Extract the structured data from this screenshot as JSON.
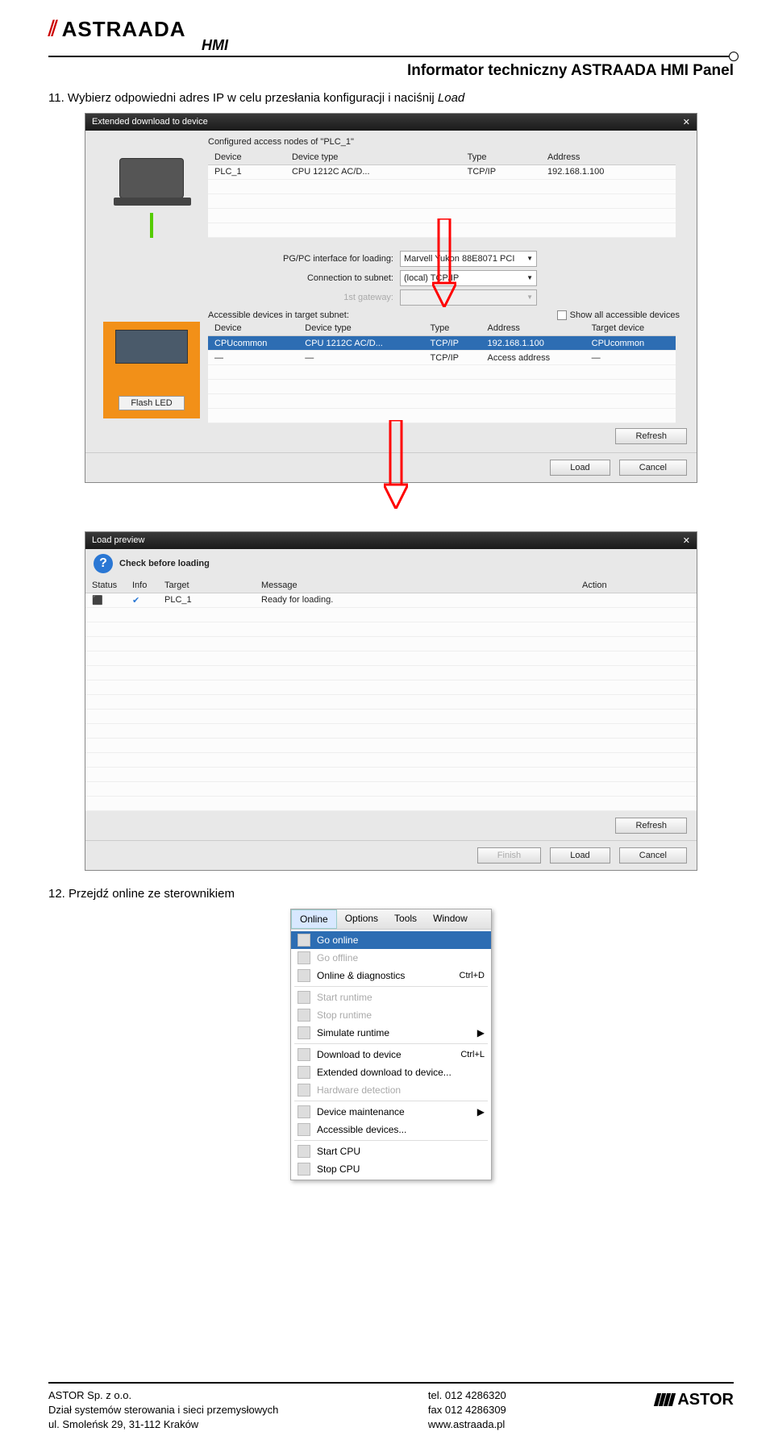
{
  "header": {
    "brand_logo": "ASTRAADA",
    "brand_sub": "HMI",
    "doc_title": "Informator techniczny ASTRAADA HMI Panel"
  },
  "step11": {
    "num": "11.",
    "text": "Wybierz odpowiedni adres IP w celu przesłania konfiguracji i naciśnij",
    "italic": "Load"
  },
  "dialog1": {
    "title": "Extended download to device",
    "configured_label": "Configured access nodes of \"PLC_1\"",
    "table1": {
      "headers": [
        "Device",
        "Device type",
        "Type",
        "Address"
      ],
      "row": [
        "PLC_1",
        "CPU 1212C AC/D...",
        "TCP/IP",
        "192.168.1.100"
      ]
    },
    "opt_interface_label": "PG/PC interface for loading:",
    "opt_interface_value": "Marvell Yukon 88E8071 PCI",
    "opt_subnet_label": "Connection to subnet:",
    "opt_subnet_value": "(local) TCP/IP",
    "opt_gateway_label": "1st gateway:",
    "accessible_label": "Accessible devices in target subnet:",
    "show_all": "Show all accessible devices",
    "table2": {
      "headers": [
        "Device",
        "Device type",
        "Type",
        "Address",
        "Target device"
      ],
      "rows": [
        [
          "CPUcommon",
          "CPU 1212C AC/D...",
          "TCP/IP",
          "192.168.1.100",
          "CPUcommon"
        ],
        [
          "—",
          "—",
          "TCP/IP",
          "Access address",
          "—"
        ]
      ]
    },
    "flash_led": "Flash LED",
    "refresh": "Refresh",
    "load": "Load",
    "cancel": "Cancel"
  },
  "dialog2": {
    "title": "Load preview",
    "check_label": "Check before loading",
    "headers": [
      "Status",
      "Info",
      "Target",
      "Message",
      "Action"
    ],
    "row": [
      "",
      "",
      "PLC_1",
      "Ready for loading.",
      ""
    ],
    "refresh": "Refresh",
    "finish": "Finish",
    "load": "Load",
    "cancel": "Cancel"
  },
  "step12": {
    "num": "12.",
    "text": "Przejdź online ze sterownikiem"
  },
  "menu": {
    "bar": [
      "Online",
      "Options",
      "Tools",
      "Window"
    ],
    "items": [
      {
        "label": "Go online",
        "selected": true
      },
      {
        "label": "Go offline",
        "disabled": true
      },
      {
        "label": "Online & diagnostics",
        "shortcut": "Ctrl+D"
      },
      {
        "sep": true
      },
      {
        "label": "Start runtime",
        "disabled": true
      },
      {
        "label": "Stop runtime",
        "disabled": true
      },
      {
        "label": "Simulate runtime",
        "arrow": true
      },
      {
        "sep": true
      },
      {
        "label": "Download to device",
        "shortcut": "Ctrl+L"
      },
      {
        "label": "Extended download to device..."
      },
      {
        "label": "Hardware detection",
        "disabled": true
      },
      {
        "sep": true
      },
      {
        "label": "Device maintenance",
        "arrow": true
      },
      {
        "label": "Accessible devices..."
      },
      {
        "sep": true
      },
      {
        "label": "Start CPU"
      },
      {
        "label": "Stop CPU"
      }
    ]
  },
  "footer": {
    "company": "ASTOR Sp. z o.o.",
    "dept": "Dział systemów sterowania i sieci przemysłowych",
    "addr": "ul. Smoleńsk 29, 31-112 Kraków",
    "tel": "tel. 012 4286320",
    "fax": "fax 012 4286309",
    "web": "www.astraada.pl",
    "astor_logo": "ASTOR"
  }
}
